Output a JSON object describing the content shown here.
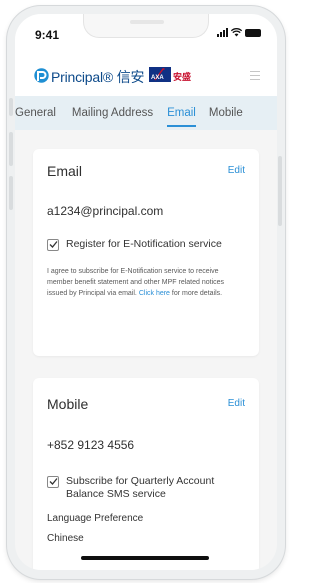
{
  "status_bar": {
    "time": "9:41"
  },
  "brand": {
    "logo_text": "Principal® 信安",
    "axa_logo": "AXA",
    "axa_cn": "安盛"
  },
  "tabs": [
    {
      "label": "General"
    },
    {
      "label": "Mailing Address"
    },
    {
      "label": "Email"
    },
    {
      "label": "Mobile"
    }
  ],
  "active_tab": "Email",
  "email_card": {
    "title": "Email",
    "edit_label": "Edit",
    "email": "a1234@principal.com",
    "checkbox_label": "Register for E-Notification service",
    "checked": true,
    "disclaimer": "I agree to subscribe for E-Notification service to receive member benefit statement and other MPF related notices issued by Principal via email.",
    "link_text": "Click here",
    "after_link": " for more details."
  },
  "mobile_card": {
    "title": "Mobile",
    "edit_label": "Edit",
    "phone": "+852 9123 4556",
    "checkbox_label_line1": "Subscribe for Quarterly Account",
    "checkbox_label_line2": "Balance SMS service",
    "checked": true,
    "language_label": "Language Preference",
    "language_value": "Chinese"
  },
  "colors": {
    "accent": "#2a8fd6",
    "tab_bar": "#e6eff4",
    "principal_blue": "#0d4a8a",
    "axa_blue": "#103184",
    "axa_red": "#c8102e"
  }
}
